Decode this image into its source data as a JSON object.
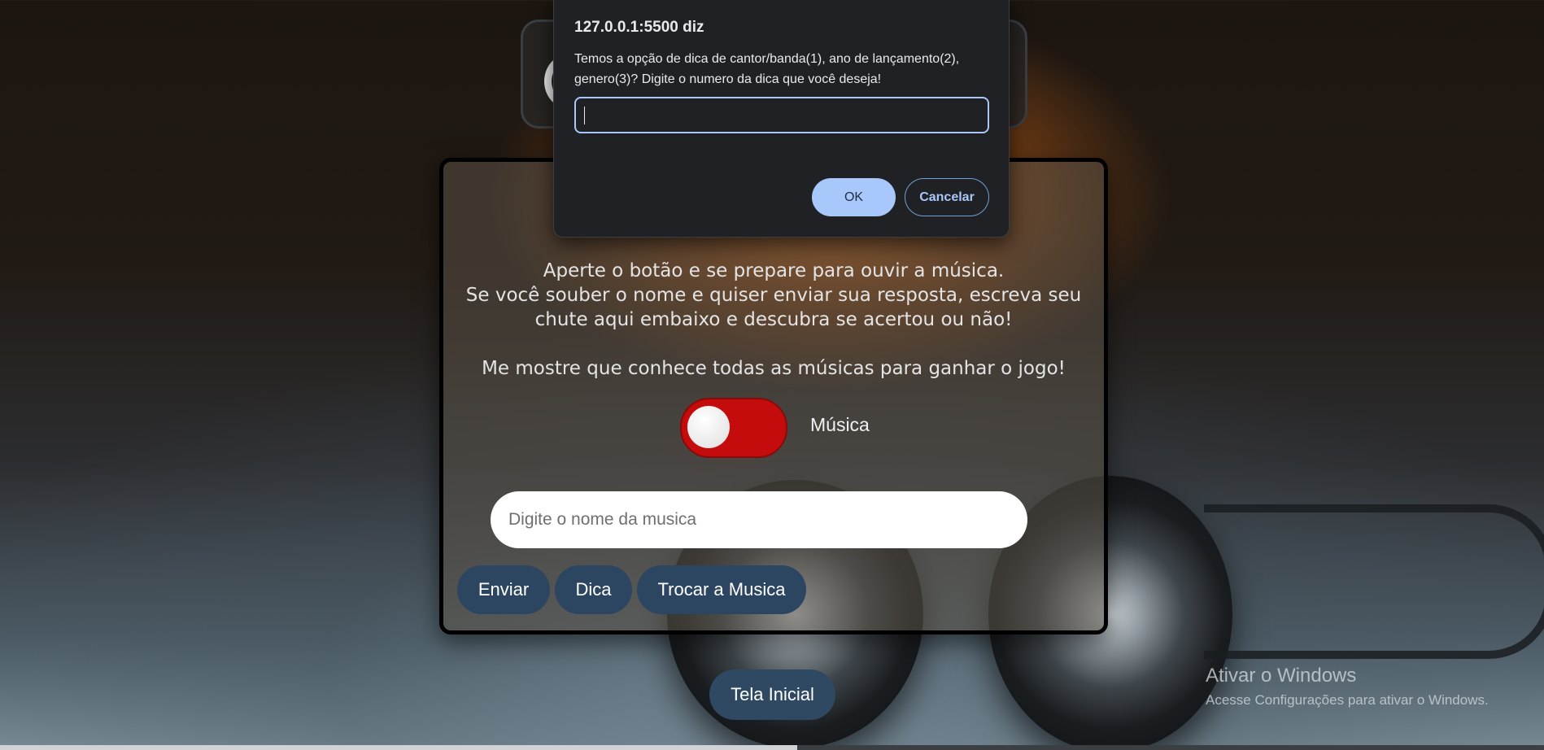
{
  "dialog": {
    "title": "127.0.0.1:5500 diz",
    "message": "Temos a opção de dica de cantor/banda(1), ano de lançamento(2), genero(3)? Digite o numero da dica que você deseja!",
    "input_value": "",
    "ok_label": "OK",
    "cancel_label": "Cancelar"
  },
  "game": {
    "instructions_line1": "Aperte o botão e se prepare para ouvir a música.",
    "instructions_line2": "Se você souber o nome e quiser enviar sua resposta, escreva seu chute aqui embaixo e descubra se acertou ou não!",
    "instructions_line3": "Me mostre que conhece todas as músicas para ganhar o jogo!",
    "toggle_label": "Música",
    "toggle_state": "off",
    "guess_placeholder": "Digite o nome da musica",
    "guess_value": "",
    "send_label": "Enviar",
    "hint_label": "Dica",
    "change_label": "Trocar a Musica"
  },
  "home_button_label": "Tela Inicial",
  "watermark": {
    "title": "Ativar o Windows",
    "subtitle": "Acesse Configurações para ativar o Windows."
  },
  "colors": {
    "toggle_off": "#c40c0c",
    "button_bg": "#2c4560",
    "dialog_accent": "#a8c7fa"
  }
}
